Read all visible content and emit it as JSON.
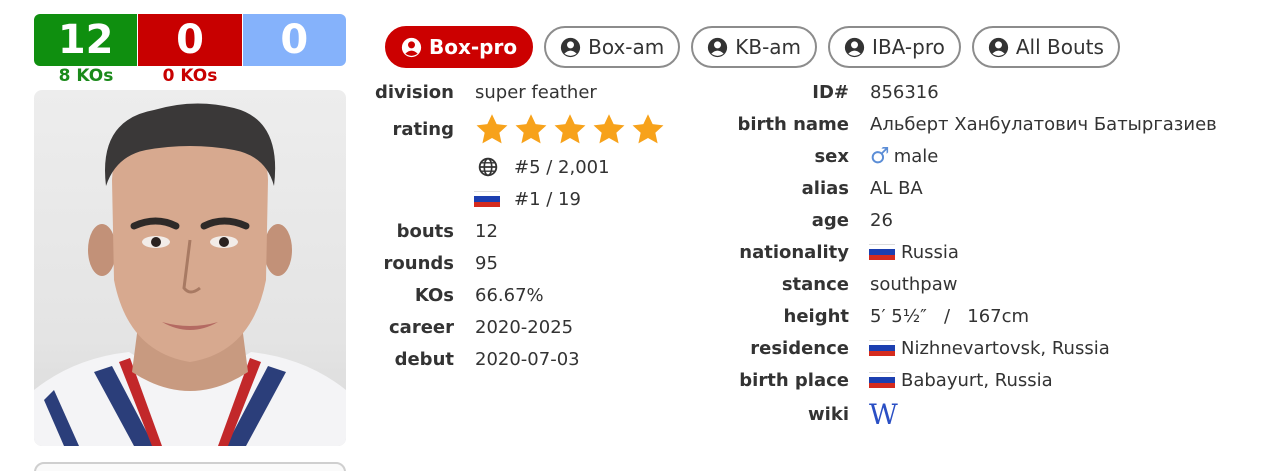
{
  "record": {
    "wins": "12",
    "losses": "0",
    "draws": "0",
    "ko_wins": "8 KOs",
    "ko_losses": "0 KOs"
  },
  "colors": {
    "win": "#0f8f0f",
    "loss": "#c80000",
    "draw": "#85b2fb",
    "active_tab": "#cc0000",
    "star": "#f7a21b"
  },
  "tabs": [
    {
      "label": "Box-pro",
      "active": true,
      "icon": "user-circle-icon"
    },
    {
      "label": "Box-am",
      "active": false,
      "icon": "user-circle-icon"
    },
    {
      "label": "KB-am",
      "active": false,
      "icon": "user-circle-icon"
    },
    {
      "label": "IBA-pro",
      "active": false,
      "icon": "user-circle-icon"
    },
    {
      "label": "All Bouts",
      "active": false,
      "icon": "user-circle-icon"
    }
  ],
  "left_info": {
    "division_label": "division",
    "division": "super feather",
    "rating_label": "rating",
    "rating_stars": 5,
    "world_rank": "#5 / 2,001",
    "country_rank": "#1 / 19",
    "bouts_label": "bouts",
    "bouts": "12",
    "rounds_label": "rounds",
    "rounds": "95",
    "kos_label": "KOs",
    "kos": "66.67%",
    "career_label": "career",
    "career": "2020-2025",
    "debut_label": "debut",
    "debut": "2020-07-03"
  },
  "right_info": {
    "id_label": "ID#",
    "id": "856316",
    "birth_name_label": "birth name",
    "birth_name": "Альберт Ханбулатович Батыргазиев",
    "sex_label": "sex",
    "sex": "male",
    "alias_label": "alias",
    "alias": "AL BA",
    "age_label": "age",
    "age": "26",
    "nationality_label": "nationality",
    "nationality": "Russia",
    "stance_label": "stance",
    "stance": "southpaw",
    "height_label": "height",
    "height": "5′ 5½″   /   167cm",
    "residence_label": "residence",
    "residence": "Nizhnevartovsk, Russia",
    "birth_place_label": "birth place",
    "birth_place": "Babayurt, Russia",
    "wiki_label": "wiki",
    "wiki_icon": "W"
  }
}
